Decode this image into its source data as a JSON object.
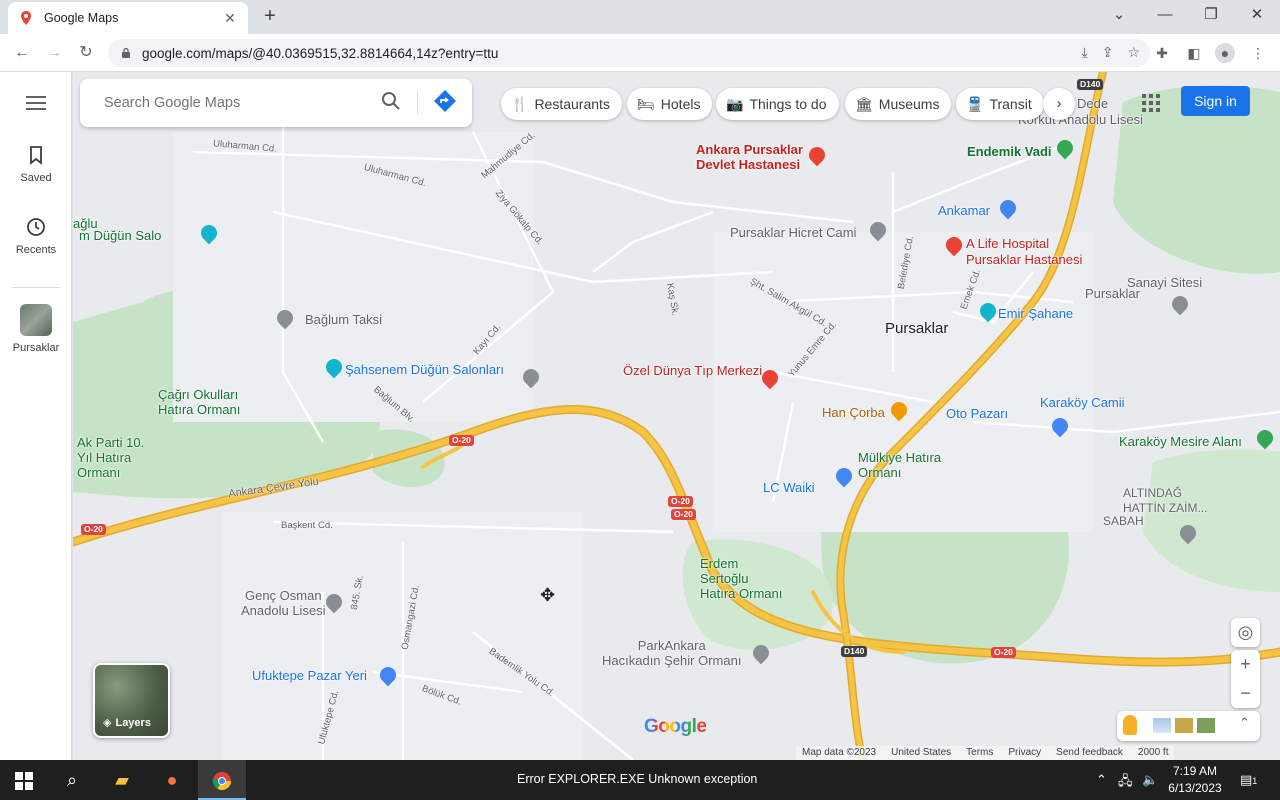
{
  "browser": {
    "tab_title": "Google Maps",
    "new_tab": "+",
    "url": "google.com/maps/@40.0369515,32.8814664,14z?entry=ttu"
  },
  "sidebar": {
    "items": [
      {
        "label": "Saved"
      },
      {
        "label": "Recents"
      },
      {
        "label": "Pursaklar"
      }
    ]
  },
  "search": {
    "placeholder": "Search Google Maps"
  },
  "chips": [
    {
      "label": "Restaurants",
      "icon": "fork-knife-icon"
    },
    {
      "label": "Hotels",
      "icon": "bed-icon"
    },
    {
      "label": "Things to do",
      "icon": "camera-icon"
    },
    {
      "label": "Museums",
      "icon": "museum-icon"
    },
    {
      "label": "Transit",
      "icon": "train-icon"
    }
  ],
  "chip_overflow_text": "Dede",
  "sign_in": "Sign in",
  "map_labels": {
    "pursaklar": "Pursaklar",
    "pursaklar_ne": "Pursaklar",
    "hospital_1": "Ankara Pursaklar\nDevlet Hastanesi",
    "hospital_2": "A Life Hospital\nPursaklar Hastanesi",
    "hicret": "Pursaklar Hicret Cami",
    "ankamar": "Ankamar",
    "endemik": "Endemik Vadi",
    "korkut": "Korkut Anadolu Lisesi",
    "sanayi": "Sanayi Sitesi",
    "emir": "Emir Şahane",
    "bagl_taksi": "Bağlum Taksi",
    "sahsenem": "Şahsenem Düğün Salonları",
    "cagri": "Çağrı Okulları\nHatıra Ormanı",
    "akparti": "Ak Parti 10.\nYıl Hatıra\nOrmanı",
    "dugun_left": "m Düğün Salo",
    "baglu": "ağlu",
    "ozel": "Özel Dünya Tıp Merkezi",
    "han_corba": "Han Çorba",
    "oto": "Oto Pazarı",
    "karakoy_cami": "Karaköy Camii",
    "karakoy_mesire": "Karaköy Mesire Alanı",
    "mulkiye": "Mülkiye Hatıra\nOrmanı",
    "lcwaiki": "LC Waiki",
    "altindag": "ALTINDAĞ\nHATTİN ZAİM...",
    "sabah": "SABAH",
    "erdem": "Erdem\nSertoğlu\nHatıra Ormanı",
    "parkankara": "ParkAnkara\nHacıkadın Şehir Ormanı",
    "genc_osman": "Genç Osman\nAnadolu Lisesi",
    "ufuktepe": "Ufuktepe Pazar Yeri",
    "ankara_cevre": "Ankara Çevre Yolu"
  },
  "road_labels": {
    "uluharman1": "Uluharman Cd.",
    "uluharman2": "Uluharman Cd.",
    "mahmudiye": "Mahmudiye Cd.",
    "ziya": "Ziya Gökalp Cd.",
    "kayi": "Kayı Cd.",
    "baglum_blv": "Bağlum Blv.",
    "baskent": "Başkent Cd.",
    "osmangazi": "Osmangazi Cd.",
    "bademlik": "Bademlik Yolu Cd.",
    "boluk": "Bölük Cd.",
    "ufuktepe_cd": "Ufuktepe Cd.",
    "s845": "845. Sk.",
    "sht_salim": "Şht. Salim Akgül Cd.",
    "yunus": "Yunus Emre Cd.",
    "belediye": "Belediye Cd.",
    "emek": "Emek Cd.",
    "kas": "Kaş Sk."
  },
  "shields": {
    "o20_a": "O-20",
    "o20_b": "O-20",
    "o20_c": "O-20",
    "o20_d": "O-20",
    "o20_e": "O-20",
    "d140_a": "D140",
    "d140_b": "D140"
  },
  "layers_label": "Layers",
  "google_logo": "Google",
  "attribution": {
    "map_data": "Map data ©2023",
    "region": "United States",
    "terms": "Terms",
    "privacy": "Privacy",
    "feedback": "Send feedback",
    "scale": "2000 ft"
  },
  "taskbar": {
    "error_text": "Error EXPLORER.EXE Unknown exception",
    "time": "7:19 AM",
    "date": "6/13/2023",
    "notification_count": "1"
  },
  "colors": {
    "highway": "#f6c445",
    "highway_edge": "#e3a92e",
    "park": "#c1e1c1",
    "accent": "#1a73e8",
    "hospital_red": "#ea4335"
  }
}
